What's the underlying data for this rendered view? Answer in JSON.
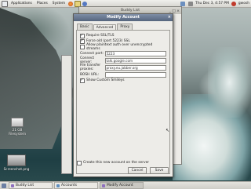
{
  "top_panel": {
    "menus": [
      "Applications",
      "Places",
      "System"
    ],
    "tray_time": "Thu Dec 3, 4:57 PM",
    "user": "gwosh"
  },
  "desktop": {
    "icon1_label": "21 GB Filesystem",
    "icon2_label": "Screenshot.png"
  },
  "buddy_list": {
    "title": "Buddy List"
  },
  "modify_account": {
    "title": "Modify Account",
    "tabs": [
      "Basic",
      "Advanced",
      "Proxy"
    ],
    "active_tab": "Advanced",
    "checkboxes": [
      {
        "label": "Require SSL/TLS",
        "checked": true
      },
      {
        "label": "Force old (port 5223) SSL",
        "checked": true
      },
      {
        "label": "Allow plaintext auth over unencrypted streams",
        "checked": false
      }
    ],
    "fields": [
      {
        "label": "Connect port:",
        "value": "5223"
      },
      {
        "label": "Connect server:",
        "value": "talk.google.com"
      },
      {
        "label": "File transfer proxies:",
        "value": "proxy.eu.jabber.org"
      },
      {
        "label": "BOSH URL:",
        "value": ""
      }
    ],
    "show_smileys": {
      "label": "Show Custom Smileys",
      "checked": true
    },
    "create_new": {
      "label": "Create this new account on the server",
      "checked": false
    },
    "cancel_label": "Cancel",
    "save_label": "Save"
  },
  "bottom_panel": {
    "tasks": [
      "Buddy List",
      "Accounts",
      "Modify Account"
    ]
  },
  "colors": {
    "title_active": "#56657e",
    "panel": "#d6d5cf"
  }
}
